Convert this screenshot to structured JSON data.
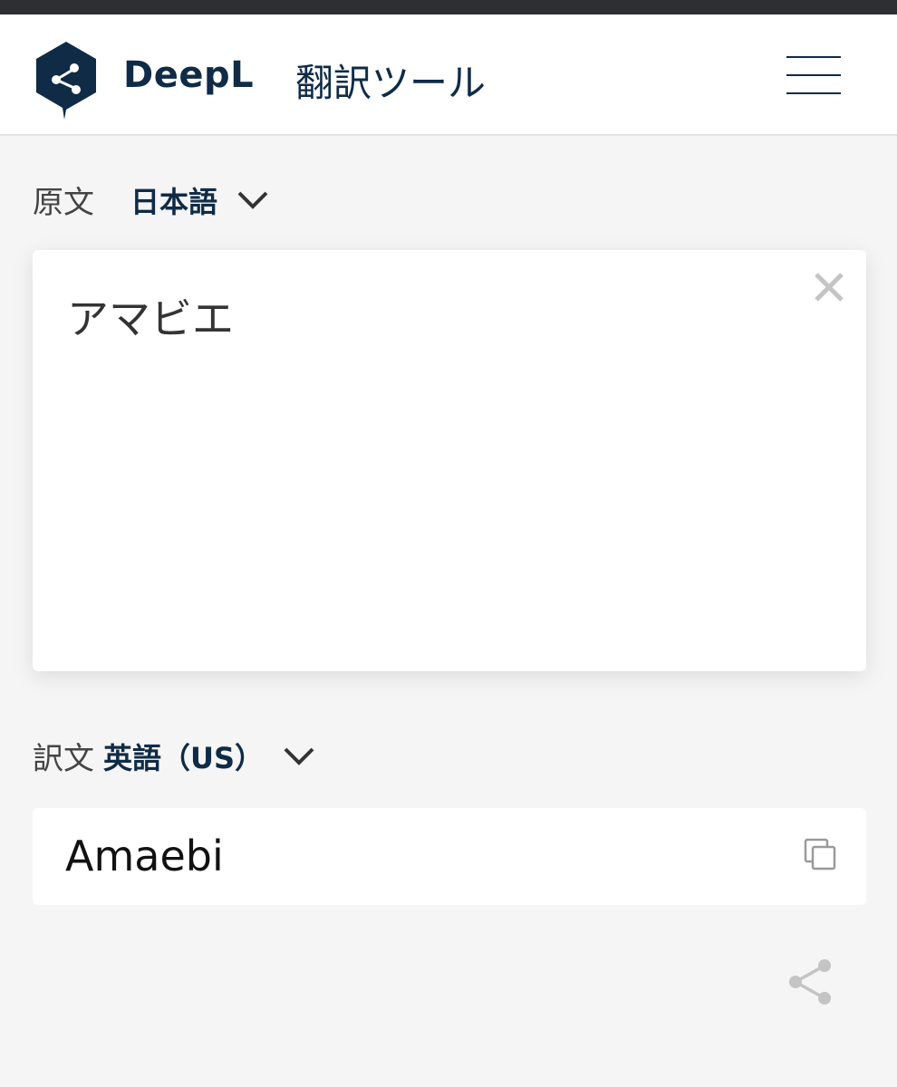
{
  "header": {
    "brand": "DeepL",
    "tool_title": "翻訳ツール",
    "logo_icon": "deepl-logo-icon",
    "menu_icon": "hamburger-menu-icon"
  },
  "source": {
    "caption": "原文",
    "language": "日本語",
    "text": "アマビエ",
    "clear_icon": "close-icon"
  },
  "target": {
    "caption": "訳文",
    "language": "英語（US）",
    "text": "Amaebi",
    "copy_icon": "copy-icon"
  },
  "actions": {
    "share_icon": "share-icon"
  },
  "colors": {
    "brand_navy": "#0f2b46",
    "background": "#f5f5f5",
    "panel": "#ffffff",
    "muted_icon": "#c4c4c4"
  }
}
